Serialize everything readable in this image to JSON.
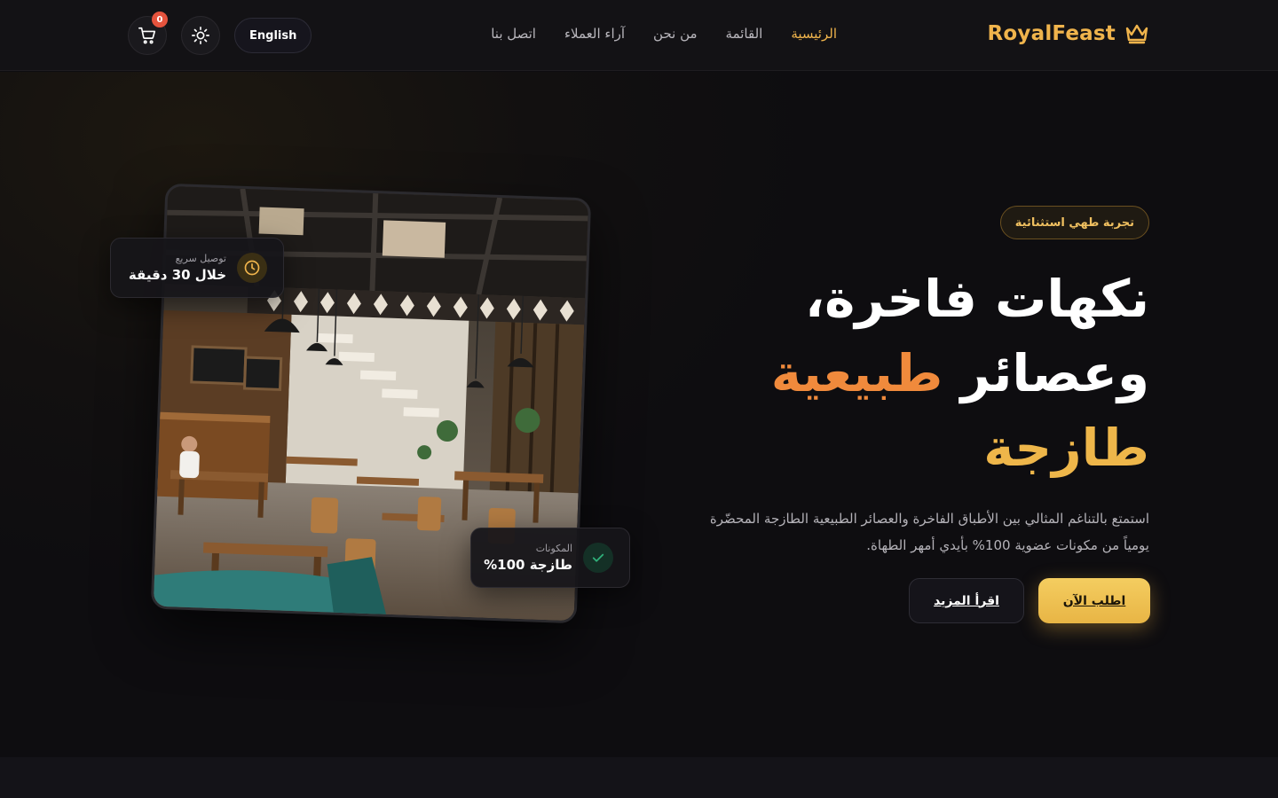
{
  "header": {
    "brand": "RoyalFeast",
    "nav": [
      {
        "label": "الرئيسية",
        "active": true
      },
      {
        "label": "القائمة",
        "active": false
      },
      {
        "label": "من نحن",
        "active": false
      },
      {
        "label": "آراء العملاء",
        "active": false
      },
      {
        "label": "اتصل بنا",
        "active": false
      }
    ],
    "language_button": "English",
    "cart_count": "0",
    "icons": {
      "brand": "crown-icon",
      "theme": "sun-icon",
      "cart": "cart-icon"
    }
  },
  "hero": {
    "tag": "تجربة طهي استثنائية",
    "headline_line1": "نكهات فاخرة،",
    "headline_line2_plain": "وعصائر",
    "headline_line2_accent": "طبيعية",
    "headline_line3": "طازجة",
    "description": "استمتع بالتناغم المثالي بين الأطباق الفاخرة والعصائر الطبيعية الطازجة المحضّرة يومياً من مكونات عضوية 100% بأيدي أمهر الطهاة.",
    "primary_button": "اطلب الآن",
    "secondary_button": "اقرأ المزيد",
    "delivery_card": {
      "label": "توصيل سريع",
      "value": "خلال 30 دقيقة",
      "icon": "clock-icon"
    },
    "fresh_card": {
      "label": "المكونات",
      "value": "طازجة 100%",
      "icon": "check-icon"
    },
    "image": "restaurant-interior-photo"
  },
  "colors": {
    "background": "#0e0d10",
    "brand_gold": "#f0b44c",
    "accent_orange": "#f08a3c",
    "badge_red": "#e5533d",
    "check_green": "#2fb07a"
  }
}
